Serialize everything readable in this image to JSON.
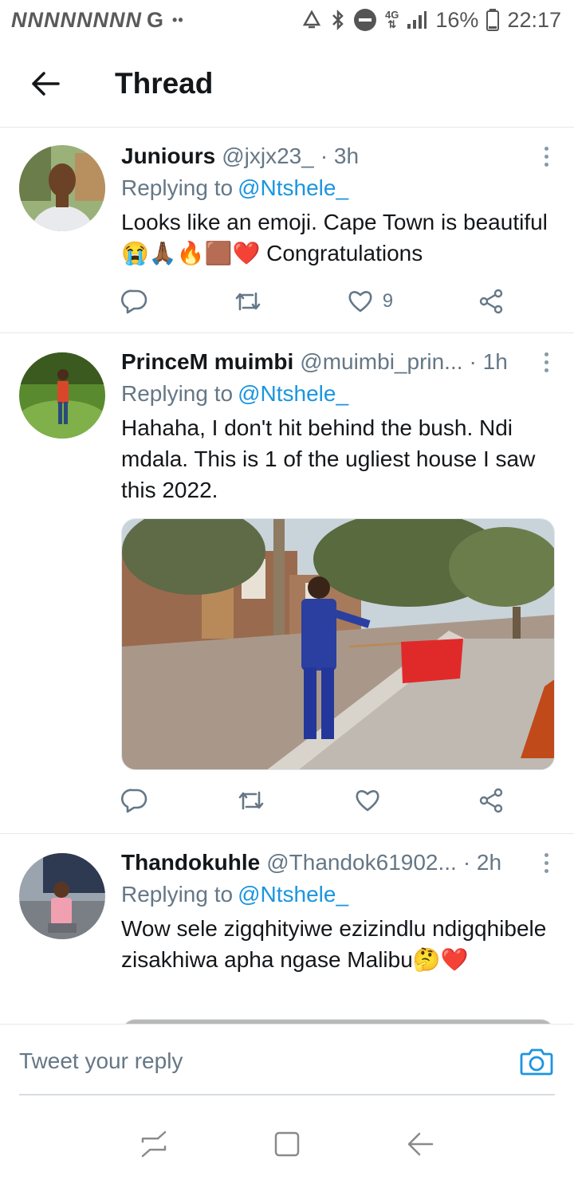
{
  "status_bar": {
    "left_glyphs": "NNNNNNNN",
    "left_g": "G",
    "left_dots": "••",
    "network": "4G",
    "battery": "16%",
    "time": "22:17"
  },
  "header": {
    "title": "Thread"
  },
  "tweets": [
    {
      "name": "Juniours",
      "handle": "@jxjx23_",
      "time": "· 3h",
      "replying_label": "Replying to",
      "replying_to": "@Ntshele_",
      "text": "Looks like an emoji. Cape Town is beautiful 😭🙏🏾🔥🟫❤️ Congratulations",
      "likes": "9",
      "colors": {
        "avatar_bg": "#8fa870",
        "avatar_shirt": "#e8eaee",
        "avatar_skin": "#6b4226"
      }
    },
    {
      "name": "PrinceM muimbi",
      "handle": "@muimbi_prin...",
      "time": "· 1h",
      "replying_label": "Replying to",
      "replying_to": "@Ntshele_",
      "text": "Hahaha, I don't hit behind the bush. Ndi mdala. This is 1 of the ugliest house I saw this 2022.",
      "likes": "",
      "colors": {
        "avatar_bg": "#6f9a3c",
        "avatar_shirt": "#d9472b",
        "avatar_skin": "#4a2c1a"
      }
    },
    {
      "name": "Thandokuhle",
      "handle": "@Thandok61902...",
      "time": "· 2h",
      "replying_label": "Replying to",
      "replying_to": "@Ntshele_",
      "text": "Wow sele zigqhityiwe ezizindlu ndigqhibele zisakhiwa apha ngase Malibu🤔❤️",
      "likes": "",
      "colors": {
        "avatar_bg": "#3f4a5a",
        "avatar_shirt": "#f0a0b0",
        "avatar_skin": "#5a3722"
      }
    }
  ],
  "compose": {
    "placeholder": "Tweet your reply"
  },
  "colors": {
    "accent": "#1b95e0",
    "muted": "#657786",
    "text": "#14171a",
    "divider": "#e1e8ed"
  }
}
